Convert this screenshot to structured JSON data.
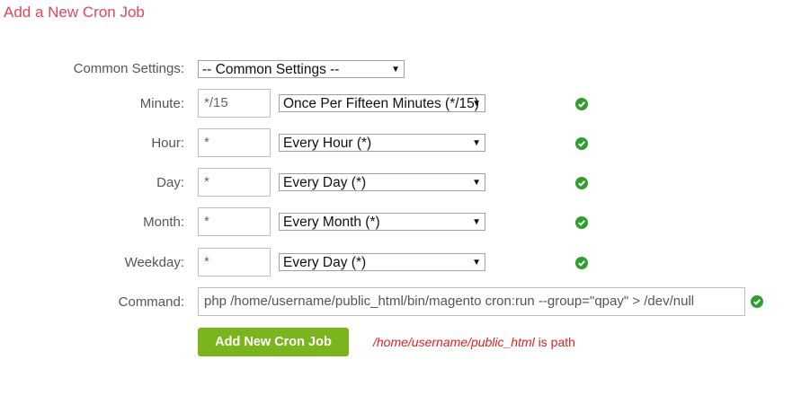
{
  "page": {
    "title": "Add a New Cron Job"
  },
  "common": {
    "label": "Common Settings:",
    "selected": "-- Common Settings --"
  },
  "rows": {
    "minute": {
      "label": "Minute:",
      "value": "*/15",
      "selected": "Once Per Fifteen Minutes (*/15)"
    },
    "hour": {
      "label": "Hour:",
      "value": "*",
      "selected": "Every Hour (*)"
    },
    "day": {
      "label": "Day:",
      "value": "*",
      "selected": "Every Day (*)"
    },
    "month": {
      "label": "Month:",
      "value": "*",
      "selected": "Every Month (*)"
    },
    "weekday": {
      "label": "Weekday:",
      "value": "*",
      "selected": "Every Day (*)"
    }
  },
  "command": {
    "label": "Command:",
    "value": "php /home/username/public_html/bin/magento cron:run --group=\"qpay\" > /dev/null"
  },
  "submit": {
    "label": "Add New Cron Job"
  },
  "note": {
    "path": "/home/username/public_html",
    "suffix": " is path"
  },
  "icons": {
    "valid": "check-circle-icon"
  },
  "colors": {
    "title": "#e0455e",
    "button": "#7ab51d",
    "valid": "#2e9e2e",
    "note": "#e02020"
  }
}
